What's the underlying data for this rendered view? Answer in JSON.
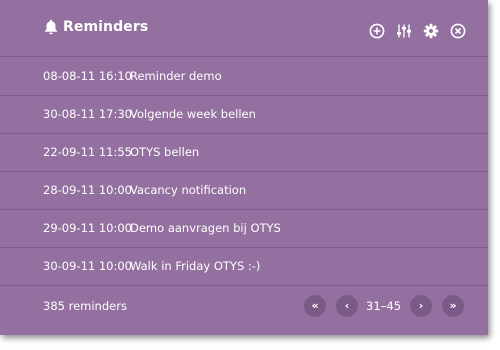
{
  "header": {
    "title": "Reminders",
    "icons": [
      "bell-icon",
      "add-circle-icon",
      "sliders-icon",
      "gear-icon",
      "close-circle-icon"
    ]
  },
  "reminders": [
    {
      "date": "08-08-11 16:10",
      "text": "Reminder demo"
    },
    {
      "date": "30-08-11 17:30",
      "text": "Volgende week bellen"
    },
    {
      "date": "22-09-11 11:55",
      "text": "OTYS bellen"
    },
    {
      "date": "28-09-11 10:00",
      "text": "Vacancy notification"
    },
    {
      "date": "29-09-11 10:00",
      "text": "Demo aanvragen bij OTYS"
    },
    {
      "date": "30-09-11 10:00",
      "text": "Walk in Friday OTYS :-)"
    }
  ],
  "footer": {
    "count": "385 reminders",
    "first": "«",
    "prev": "‹",
    "pages": "31–45",
    "next": "›",
    "last": "»"
  },
  "colors": {
    "panel": "#93709f",
    "divider": "#7f5d8b",
    "button": "#7a5a86",
    "text": "#ffffff"
  }
}
